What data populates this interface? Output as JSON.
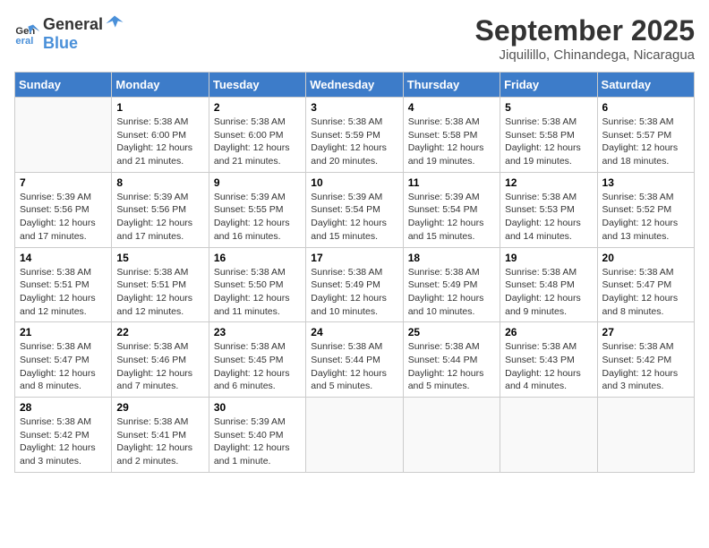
{
  "logo": {
    "text_general": "General",
    "text_blue": "Blue"
  },
  "title": "September 2025",
  "location": "Jiquilillo, Chinandega, Nicaragua",
  "days_of_week": [
    "Sunday",
    "Monday",
    "Tuesday",
    "Wednesday",
    "Thursday",
    "Friday",
    "Saturday"
  ],
  "weeks": [
    [
      {
        "day": null,
        "info": null
      },
      {
        "day": "1",
        "sunrise": "5:38 AM",
        "sunset": "6:00 PM",
        "daylight": "12 hours and 21 minutes."
      },
      {
        "day": "2",
        "sunrise": "5:38 AM",
        "sunset": "6:00 PM",
        "daylight": "12 hours and 21 minutes."
      },
      {
        "day": "3",
        "sunrise": "5:38 AM",
        "sunset": "5:59 PM",
        "daylight": "12 hours and 20 minutes."
      },
      {
        "day": "4",
        "sunrise": "5:38 AM",
        "sunset": "5:58 PM",
        "daylight": "12 hours and 19 minutes."
      },
      {
        "day": "5",
        "sunrise": "5:38 AM",
        "sunset": "5:58 PM",
        "daylight": "12 hours and 19 minutes."
      },
      {
        "day": "6",
        "sunrise": "5:38 AM",
        "sunset": "5:57 PM",
        "daylight": "12 hours and 18 minutes."
      }
    ],
    [
      {
        "day": "7",
        "sunrise": "5:39 AM",
        "sunset": "5:56 PM",
        "daylight": "12 hours and 17 minutes."
      },
      {
        "day": "8",
        "sunrise": "5:39 AM",
        "sunset": "5:56 PM",
        "daylight": "12 hours and 17 minutes."
      },
      {
        "day": "9",
        "sunrise": "5:39 AM",
        "sunset": "5:55 PM",
        "daylight": "12 hours and 16 minutes."
      },
      {
        "day": "10",
        "sunrise": "5:39 AM",
        "sunset": "5:54 PM",
        "daylight": "12 hours and 15 minutes."
      },
      {
        "day": "11",
        "sunrise": "5:39 AM",
        "sunset": "5:54 PM",
        "daylight": "12 hours and 15 minutes."
      },
      {
        "day": "12",
        "sunrise": "5:38 AM",
        "sunset": "5:53 PM",
        "daylight": "12 hours and 14 minutes."
      },
      {
        "day": "13",
        "sunrise": "5:38 AM",
        "sunset": "5:52 PM",
        "daylight": "12 hours and 13 minutes."
      }
    ],
    [
      {
        "day": "14",
        "sunrise": "5:38 AM",
        "sunset": "5:51 PM",
        "daylight": "12 hours and 12 minutes."
      },
      {
        "day": "15",
        "sunrise": "5:38 AM",
        "sunset": "5:51 PM",
        "daylight": "12 hours and 12 minutes."
      },
      {
        "day": "16",
        "sunrise": "5:38 AM",
        "sunset": "5:50 PM",
        "daylight": "12 hours and 11 minutes."
      },
      {
        "day": "17",
        "sunrise": "5:38 AM",
        "sunset": "5:49 PM",
        "daylight": "12 hours and 10 minutes."
      },
      {
        "day": "18",
        "sunrise": "5:38 AM",
        "sunset": "5:49 PM",
        "daylight": "12 hours and 10 minutes."
      },
      {
        "day": "19",
        "sunrise": "5:38 AM",
        "sunset": "5:48 PM",
        "daylight": "12 hours and 9 minutes."
      },
      {
        "day": "20",
        "sunrise": "5:38 AM",
        "sunset": "5:47 PM",
        "daylight": "12 hours and 8 minutes."
      }
    ],
    [
      {
        "day": "21",
        "sunrise": "5:38 AM",
        "sunset": "5:47 PM",
        "daylight": "12 hours and 8 minutes."
      },
      {
        "day": "22",
        "sunrise": "5:38 AM",
        "sunset": "5:46 PM",
        "daylight": "12 hours and 7 minutes."
      },
      {
        "day": "23",
        "sunrise": "5:38 AM",
        "sunset": "5:45 PM",
        "daylight": "12 hours and 6 minutes."
      },
      {
        "day": "24",
        "sunrise": "5:38 AM",
        "sunset": "5:44 PM",
        "daylight": "12 hours and 5 minutes."
      },
      {
        "day": "25",
        "sunrise": "5:38 AM",
        "sunset": "5:44 PM",
        "daylight": "12 hours and 5 minutes."
      },
      {
        "day": "26",
        "sunrise": "5:38 AM",
        "sunset": "5:43 PM",
        "daylight": "12 hours and 4 minutes."
      },
      {
        "day": "27",
        "sunrise": "5:38 AM",
        "sunset": "5:42 PM",
        "daylight": "12 hours and 3 minutes."
      }
    ],
    [
      {
        "day": "28",
        "sunrise": "5:38 AM",
        "sunset": "5:42 PM",
        "daylight": "12 hours and 3 minutes."
      },
      {
        "day": "29",
        "sunrise": "5:38 AM",
        "sunset": "5:41 PM",
        "daylight": "12 hours and 2 minutes."
      },
      {
        "day": "30",
        "sunrise": "5:39 AM",
        "sunset": "5:40 PM",
        "daylight": "12 hours and 1 minute."
      },
      {
        "day": null,
        "info": null
      },
      {
        "day": null,
        "info": null
      },
      {
        "day": null,
        "info": null
      },
      {
        "day": null,
        "info": null
      }
    ]
  ]
}
